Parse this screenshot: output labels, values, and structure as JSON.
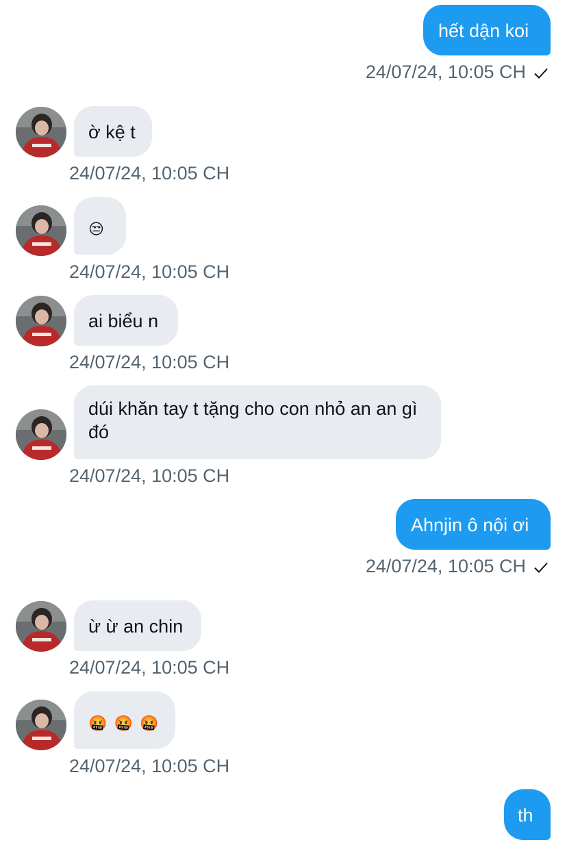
{
  "colors": {
    "outgoing_bubble": "#1d9bf0",
    "incoming_bubble": "#e8ecf0",
    "timestamp": "#536471"
  },
  "contact": {
    "avatar_icon": "user-avatar-red-hoodie",
    "hoodie_text": "AMPARIS"
  },
  "messages": [
    {
      "direction": "outgoing",
      "text": "hết dận koi",
      "timestamp": "24/07/24, 10:05 CH",
      "seen": true
    },
    {
      "direction": "incoming",
      "text": "ờ kệ t",
      "timestamp": "24/07/24, 10:05 CH"
    },
    {
      "direction": "incoming",
      "text": "😒",
      "timestamp": "24/07/24, 10:05 CH"
    },
    {
      "direction": "incoming",
      "text": "ai biểu n",
      "timestamp": "24/07/24, 10:05 CH"
    },
    {
      "direction": "incoming",
      "text": "dúi khăn tay t tặng cho con nhỏ an an gì đó",
      "timestamp": "24/07/24, 10:05 CH"
    },
    {
      "direction": "outgoing",
      "text": "Ahnjin ô nội ơi",
      "timestamp": "24/07/24, 10:05 CH",
      "seen": true
    },
    {
      "direction": "incoming",
      "text": "ừ ừ an chin",
      "timestamp": "24/07/24, 10:05 CH"
    },
    {
      "direction": "incoming",
      "text": "🤬 🤬 🤬",
      "timestamp": "24/07/24, 10:05 CH"
    },
    {
      "direction": "outgoing",
      "text": "th"
    }
  ]
}
